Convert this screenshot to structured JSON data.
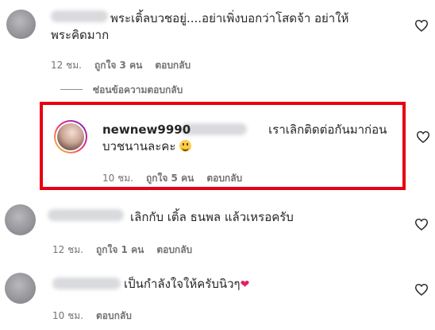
{
  "comments": [
    {
      "text": "พระเติ้ลบวชอยู่....อย่าเพิ่งบอกว่าโสดจ้า อย่าให้พระคิดมาก",
      "time": "12 ชม.",
      "likes": "ถูกใจ 3 คน",
      "reply": "ตอบกลับ"
    },
    {
      "username": "newnew9990",
      "text": "เราเลิกติดต่อกันมาก่อนบวชนานละคะ",
      "time": "10 ชม.",
      "likes": "ถูกใจ 5 คน",
      "reply": "ตอบกลับ"
    },
    {
      "text": "เลิกกับ เติ้ล ธนพล แล้วเหรอครับ",
      "time": "12 ชม.",
      "likes": "ถูกใจ 1 คน",
      "reply": "ตอบกลับ"
    },
    {
      "text": "เป็นกำลังใจให้ครับนิวๆ",
      "time": "10 ชม.",
      "reply": "ตอบกลับ"
    }
  ],
  "hide_replies": "ซ่อนข้อความตอบกลับ",
  "colors": {
    "highlight": "#e60012",
    "muted": "#737373",
    "text": "#262626"
  },
  "icons": {
    "like": "heart-outline-icon",
    "emoji_smile": "smiling-face-emoji",
    "emoji_heart": "red-heart-emoji"
  }
}
